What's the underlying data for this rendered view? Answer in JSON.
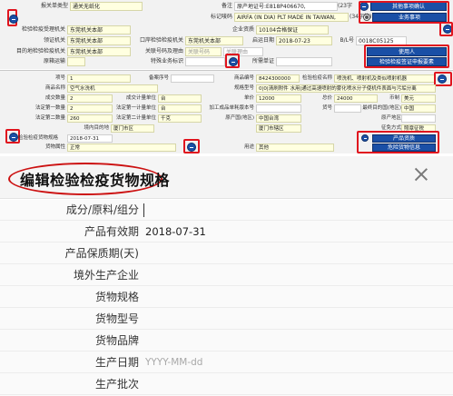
{
  "top": {
    "r1": {
      "l1": "报关单类型",
      "v1": "通关无纸化",
      "l2": "备注",
      "v2": "原产地证号:E818P406670,",
      "v3": "(23字",
      "btn1": "其他事项确认"
    },
    "r2": {
      "l1": "标记唛码",
      "v1": "AIRFA (IN DIA) PLT MADE IN TAIWAN,",
      "v2": "(34字符)",
      "btn1": "业务事项"
    },
    "r3": {
      "l1": "检验检疫受理机关",
      "v1": "东莞机关本部",
      "l2": "企业资质",
      "v2": "10104合格保证"
    },
    "r4": {
      "l1": "领证机关",
      "v1": "东莞机关本部",
      "l2": "口岸检验检疫机关",
      "v2": "东莞机关本部",
      "l3": "启运日期",
      "v3": "2018-07-23",
      "l4": "B/L号",
      "v4": "0018C05125"
    },
    "r5": {
      "l1": "目的地检验检疫机关",
      "v1": "东莞机关本部",
      "l2": "关联号码及理由",
      "v2": "关联号码",
      "v3": "关联理由",
      "btn1": "使用人"
    },
    "r6": {
      "l1": "原箱运输",
      "l2": "特殊业务标识",
      "l3": "所需单证",
      "btn1": "检验检疫签证申报要素"
    }
  },
  "mid": {
    "r1": {
      "l1": "项号",
      "v1": "1",
      "l2": "备案序号",
      "l3": "商品编号",
      "v3": "8424300000",
      "l4": "检验检疫名称",
      "v4": "喷洗机、喷射机及类似喷射机器"
    },
    "r2": {
      "l1": "商品名称",
      "v1": "空气水洗机",
      "l2": "规格型号",
      "v2": "0|0|清刷附件 水用|通过高速喷射的雾化喷水分子使机件表面与污垢分离"
    },
    "r3": {
      "l1": "成交数量",
      "v1": "2",
      "l2": "成交计量单位",
      "v2": "台",
      "l3": "单价",
      "v3": "12000",
      "l4": "总价",
      "v4": "24000",
      "l5": "币制",
      "v5": "美元"
    },
    "r4": {
      "l1": "法定第一数量",
      "v1": "2",
      "l2": "法定第一计量单位",
      "v2": "台",
      "l3": "加工成品单耗版本号",
      "l4": "货号",
      "l5": "最终目的国(地区)",
      "v5": "中国"
    },
    "r5": {
      "l1": "法定第二数量",
      "v1": "260",
      "l2": "法定第二计量单位",
      "v2": "千克",
      "l3": "原产国(地区)",
      "v3": "中国台湾",
      "l4": "原产地区"
    },
    "r6": {
      "l1": "境内目的地",
      "v1": "厦门市区",
      "l2": "厦门市辖区",
      "l3": "征免方式",
      "v3": "照章征税"
    },
    "r7": {
      "l1": "检验检疫货物规格",
      "v1": "2018-07-31",
      "btn1": "产品资质"
    },
    "r8": {
      "l1": "货物属性",
      "v1": "正常",
      "l2": "用途",
      "v2": "其他",
      "btn1": "危险货物信息"
    }
  },
  "dialog": {
    "title": "编辑检验检疫货物规格",
    "fields": [
      {
        "label": "成分/原料/组分",
        "value": "",
        "placeholder": ""
      },
      {
        "label": "产品有效期",
        "value": "2018-07-31",
        "placeholder": ""
      },
      {
        "label": "产品保质期(天)",
        "value": "",
        "placeholder": ""
      },
      {
        "label": "境外生产企业",
        "value": "",
        "placeholder": ""
      },
      {
        "label": "货物规格",
        "value": "",
        "placeholder": ""
      },
      {
        "label": "货物型号",
        "value": "",
        "placeholder": ""
      },
      {
        "label": "货物品牌",
        "value": "",
        "placeholder": ""
      },
      {
        "label": "生产日期",
        "value": "",
        "placeholder": "YYYY-MM-dd"
      },
      {
        "label": "生产批次",
        "value": "",
        "placeholder": ""
      }
    ]
  },
  "colors": {
    "accent_blue": "#1a4fa6",
    "highlight_red": "#e0141e",
    "field_yellow": "#ffffe0"
  }
}
